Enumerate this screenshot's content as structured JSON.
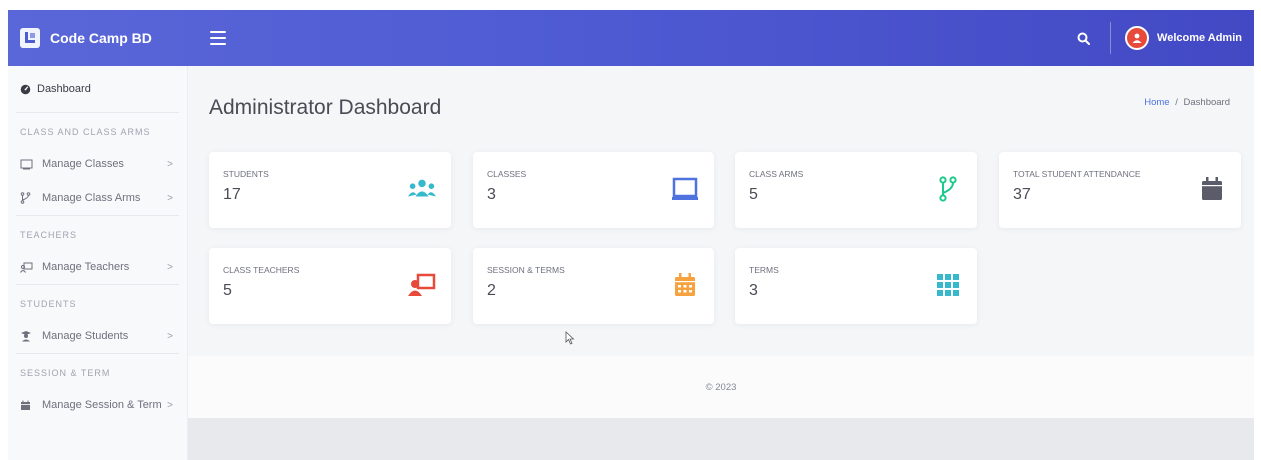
{
  "brand": {
    "name": "Code Camp BD"
  },
  "header": {
    "user_label": "Welcome Admin"
  },
  "sidebar": {
    "dashboard": "Dashboard",
    "sections": [
      {
        "heading": "CLASS AND CLASS ARMS",
        "items": [
          {
            "label": "Manage Classes",
            "icon": "chalkboard-icon"
          },
          {
            "label": "Manage Class Arms",
            "icon": "code-branch-icon"
          }
        ]
      },
      {
        "heading": "TEACHERS",
        "items": [
          {
            "label": "Manage Teachers",
            "icon": "chalkboard-teacher-icon"
          }
        ]
      },
      {
        "heading": "STUDENTS",
        "items": [
          {
            "label": "Manage Students",
            "icon": "user-graduate-icon"
          }
        ]
      },
      {
        "heading": "SESSION & TERM",
        "items": [
          {
            "label": "Manage Session & Term",
            "icon": "calendar-icon"
          }
        ]
      }
    ],
    "chevron": ">"
  },
  "main": {
    "title": "Administrator Dashboard",
    "breadcrumb": {
      "home": "Home",
      "separator": "/",
      "current": "Dashboard"
    },
    "cards": [
      {
        "label": "STUDENTS",
        "value": "17",
        "icon": "users-icon",
        "color": "#36b9cc"
      },
      {
        "label": "CLASSES",
        "value": "3",
        "icon": "chalkboard-icon",
        "color": "#4e73df"
      },
      {
        "label": "CLASS ARMS",
        "value": "5",
        "icon": "code-branch-icon",
        "color": "#1cc88a"
      },
      {
        "label": "TOTAL STUDENT ATTENDANCE",
        "value": "37",
        "icon": "calendar-icon",
        "color": "#5a5c69"
      },
      {
        "label": "CLASS TEACHERS",
        "value": "5",
        "icon": "chalkboard-teacher-icon",
        "color": "#e74a3b"
      },
      {
        "label": "SESSION & TERMS",
        "value": "2",
        "icon": "calendar-alt-icon",
        "color": "#f6a23e"
      },
      {
        "label": "TERMS",
        "value": "3",
        "icon": "th-icon",
        "color": "#36b9cc"
      }
    ],
    "footer": "© 2023"
  }
}
